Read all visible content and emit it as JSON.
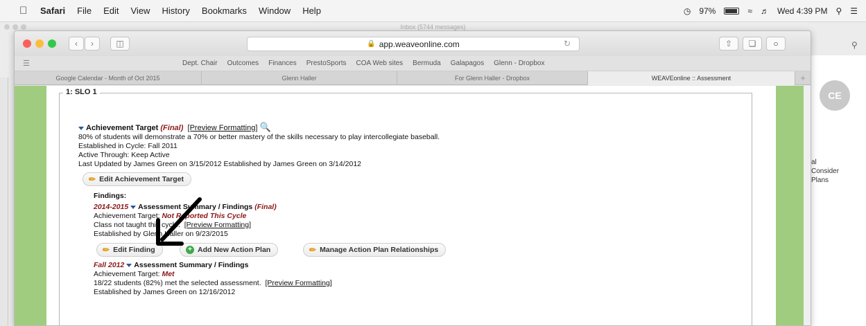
{
  "menubar": {
    "app": "Safari",
    "items": [
      "File",
      "Edit",
      "View",
      "History",
      "Bookmarks",
      "Window",
      "Help"
    ],
    "status_battery": "97%",
    "clock": "Wed 4:39 PM"
  },
  "background_window": {
    "title": "Inbox (5744 messages)"
  },
  "browser": {
    "url": "app.weaveonline.com",
    "bookmarks": [
      "Dept. Chair",
      "Outcomes",
      "Finances",
      "PrestoSports",
      "COA Web sites",
      "Bermuda",
      "Galapagos",
      "Glenn - Dropbox"
    ],
    "tabs": [
      {
        "label": "Google Calendar - Month of Oct 2015",
        "active": false
      },
      {
        "label": "Glenn Haller",
        "active": false
      },
      {
        "label": "For Glenn Haller - Dropbox",
        "active": false
      },
      {
        "label": "WEAVEonline :: Assessment",
        "active": true
      }
    ]
  },
  "right_panel": {
    "avatar_initials": "CE",
    "side_lines": [
      "al",
      "Consider",
      "Plans"
    ]
  },
  "page": {
    "section_legend": "1: SLO 1",
    "achievement": {
      "heading": "Achievement Target",
      "status": "(Final)",
      "preview_link": "[Preview Formatting]",
      "description": "80% of students will demonstrate a 70% or better mastery of the skills necessary to play intercollegiate baseball.",
      "established_cycle": "Established in Cycle: Fall 2011",
      "active_through": "Active Through: Keep Active",
      "last_updated": "Last Updated by James Green on 3/15/2012 Established by James Green on 3/14/2012",
      "edit_button": "Edit Achievement Target"
    },
    "findings_label": "Findings:",
    "finding1": {
      "cycle": "2014-2015",
      "heading": "Assessment Summary / Findings",
      "status": "(Final)",
      "target_label": "Achievement Target:",
      "target_value": "Not Reported This Cycle",
      "text": "Class not taught this cycle.",
      "preview_link": "[Preview Formatting]",
      "established": "Established by Glenn Haller on 9/23/2015"
    },
    "buttons": {
      "edit_finding": "Edit Finding",
      "add_action_plan": "Add New Action Plan",
      "manage_relationships": "Manage Action Plan Relationships"
    },
    "finding2": {
      "cycle": "Fall 2012",
      "heading": "Assessment Summary / Findings",
      "target_label": "Achievement Target:",
      "target_value": "Met",
      "text": "18/22 students (82%) met the selected assessment.",
      "preview_link": "[Preview Formatting]",
      "established": "Established by James Green on 12/16/2012"
    }
  },
  "colors": {
    "green_frame": "#9fcc7e",
    "final_red": "#8b1a1a",
    "link_blue": "#2b5797"
  }
}
